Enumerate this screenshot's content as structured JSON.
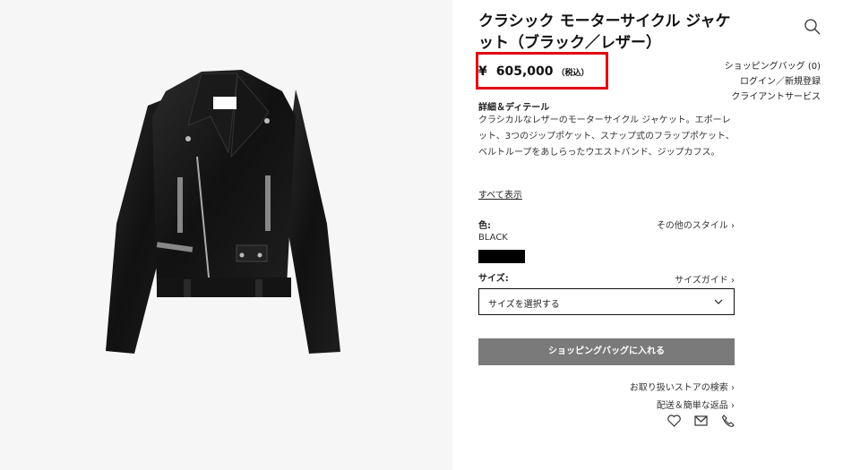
{
  "product": {
    "title": "クラシック モーターサイクル ジャケット（ブラック／レザー）",
    "price_currency": "¥",
    "price_value": "605,000",
    "price_tax_note": "（税込）"
  },
  "account": {
    "bag": "ショッピングバッグ (0)",
    "login": "ログイン／新規登録",
    "client_service": "クライアントサービス"
  },
  "details": {
    "heading": "詳細＆ディテール",
    "text": "クラシカルなレザーのモーターサイクル ジャケット。エポーレット、3つのジップポケット、スナップ式のフラップポケット、ベルトループをあしらったウエストバンド、ジップカフス。",
    "show_all": "すべて表示"
  },
  "color": {
    "label": "色:",
    "value": "BLACK",
    "other_styles": "その他のスタイル ›",
    "swatch_color": "#000000"
  },
  "size": {
    "label": "サイズ:",
    "guide": "サイズガイド ›",
    "select_placeholder": "サイズを選択する"
  },
  "actions": {
    "add_to_bag": "ショッピングバッグに入れる",
    "store_search": "お取り扱いストアの検索 ›",
    "shipping_returns": "配送＆簡単な返品 ›"
  },
  "icons": [
    "search-icon",
    "heart-icon",
    "mail-icon",
    "phone-icon",
    "chevron-down-icon"
  ],
  "colors": {
    "highlight": "#e30613",
    "button": "#7a7a7a"
  }
}
